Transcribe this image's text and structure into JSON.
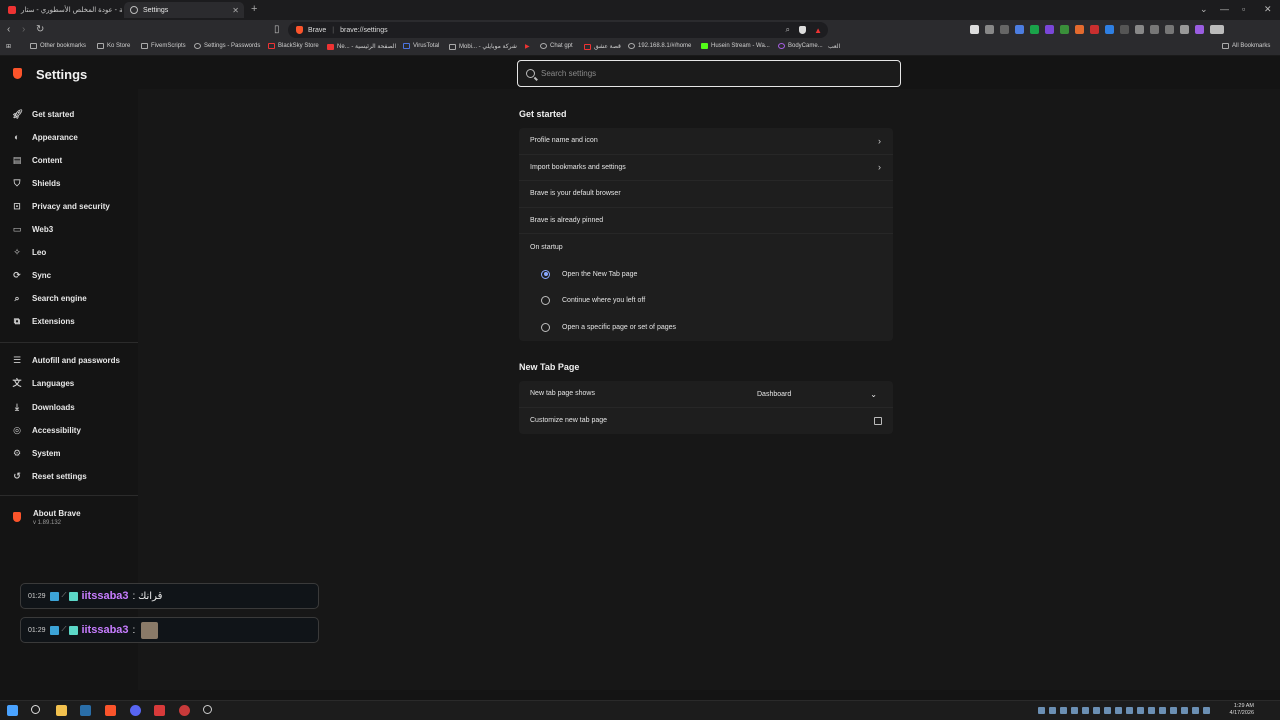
{
  "browser": {
    "tabs": [
      {
        "label": "سلسلة - عودة المخلص الأسطوري - ستار"
      },
      {
        "label": "Settings"
      }
    ],
    "url_site": "Brave",
    "url": "brave://settings",
    "bookmarks": [
      "Other bookmarks",
      "Ko Store",
      "FivemScripts",
      "Settings - Passwords",
      "BlackSky Store",
      "Ne... - الصفحة الرئيسية",
      "VirusTotal",
      "Mobi... - شركة موبايلي",
      "Chat gpt",
      "قصة عشق",
      "192.168.8.1/#/home",
      "Husein Stream - Wa...",
      "BodyCame...",
      "العب",
      "All Bookmarks"
    ]
  },
  "settings": {
    "title": "Settings",
    "search_placeholder": "Search settings",
    "nav_top": [
      {
        "label": "Get started",
        "icon": "rocket-icon"
      },
      {
        "label": "Appearance",
        "icon": "palette-icon"
      },
      {
        "label": "Content",
        "icon": "content-icon"
      },
      {
        "label": "Shields",
        "icon": "shield-icon"
      },
      {
        "label": "Privacy and security",
        "icon": "lock-icon"
      },
      {
        "label": "Web3",
        "icon": "wallet-icon"
      },
      {
        "label": "Leo",
        "icon": "leo-icon"
      },
      {
        "label": "Sync",
        "icon": "sync-icon"
      },
      {
        "label": "Search engine",
        "icon": "search-icon"
      },
      {
        "label": "Extensions",
        "icon": "puzzle-icon"
      }
    ],
    "nav_bottom": [
      {
        "label": "Autofill and passwords",
        "icon": "list-icon"
      },
      {
        "label": "Languages",
        "icon": "language-icon"
      },
      {
        "label": "Downloads",
        "icon": "download-icon"
      },
      {
        "label": "Accessibility",
        "icon": "accessibility-icon"
      },
      {
        "label": "System",
        "icon": "gear-icon"
      },
      {
        "label": "Reset settings",
        "icon": "reset-icon"
      }
    ],
    "about": {
      "title": "About Brave",
      "version": "v 1.89.132"
    },
    "get_started": {
      "heading": "Get started",
      "rows": [
        "Profile name and icon",
        "Import bookmarks and settings",
        "Brave is your default browser",
        "Brave is already pinned"
      ],
      "startup_label": "On startup",
      "startup_options": [
        "Open the New Tab page",
        "Continue where you left off",
        "Open a specific page or set of pages"
      ],
      "startup_selected": 0
    },
    "new_tab": {
      "heading": "New Tab Page",
      "shows_label": "New tab page shows",
      "shows_value": "Dashboard",
      "customize_label": "Customize new tab page"
    }
  },
  "chat": [
    {
      "time": "01:29",
      "user": "iitssaba3",
      "message": ": قرانك"
    },
    {
      "time": "01:29",
      "user": "iitssaba3",
      "message": ":"
    }
  ],
  "taskbar": {
    "time": "1:29 AM",
    "date": "4/17/2026"
  },
  "colors": {
    "brand": "#fb542b",
    "accent": "#8aa8ff",
    "chat_user": "#c77dff"
  }
}
